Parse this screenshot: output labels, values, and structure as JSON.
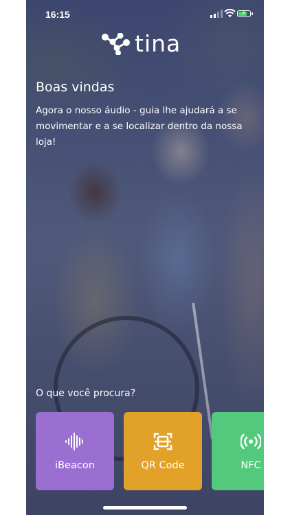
{
  "status_bar": {
    "time": "16:15"
  },
  "brand": {
    "name": "tina"
  },
  "welcome": {
    "title": "Boas vindas",
    "message": "Agora o nosso áudio - guia lhe ajudará a se movimentar e a se localizar dentro da nossa loja!"
  },
  "search": {
    "question": "O que você procura?"
  },
  "options": [
    {
      "label": "iBeacon",
      "icon": "audio-wave-icon",
      "color": "#9b6fd1"
    },
    {
      "label": "QR Code",
      "icon": "qr-scan-icon",
      "color": "#e2a22a"
    },
    {
      "label": "NFC",
      "icon": "nfc-signal-icon",
      "color": "#52c97c"
    }
  ],
  "colors": {
    "battery": "#4cd964",
    "text": "#ffffff"
  }
}
